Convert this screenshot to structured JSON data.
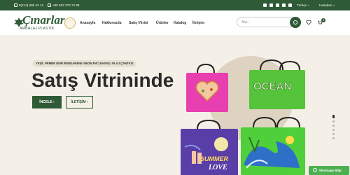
{
  "topbar": {
    "phone1": "0(212) 685 42 12",
    "phone2": "+90 553 373 74 88",
    "language": "Türkçe",
    "account": "Hesabım"
  },
  "header": {
    "logo_name": "Çınarlar",
    "logo_sub": "AMBALAJ PLASTİK",
    "nav": [
      "Anasayfa",
      "Hakkımızda",
      "Satış Vitrini",
      "Ürünler",
      "Katalog",
      "İletişim"
    ],
    "search_placeholder": "Ara...",
    "cart_count": "0"
  },
  "hero": {
    "subtitle": "YEŞİL PEMBE MOR RENGARENK NEON PVC BASKILI PLAJ ÇANTASI",
    "title": "Satış Vitrininde",
    "primary_button": "İNCELE ›",
    "secondary_button": "İLETİŞİM ›",
    "bag_texts": [
      "OCEAN",
      "SUMMER",
      "LOVE"
    ],
    "slide_count": 6,
    "active_slide": 1
  },
  "whatsapp": {
    "label": "Whatsapp Bilgi"
  },
  "colors": {
    "brand_green": "#2f5a36",
    "background": "#f4f0e8",
    "whatsapp": "#4caf50"
  },
  "icons": [
    "phone-icon",
    "facebook-icon",
    "instagram-icon",
    "twitter-icon",
    "youtube-icon",
    "linkedin-icon",
    "search-icon",
    "heart-icon",
    "cart-icon",
    "whatsapp-icon"
  ]
}
